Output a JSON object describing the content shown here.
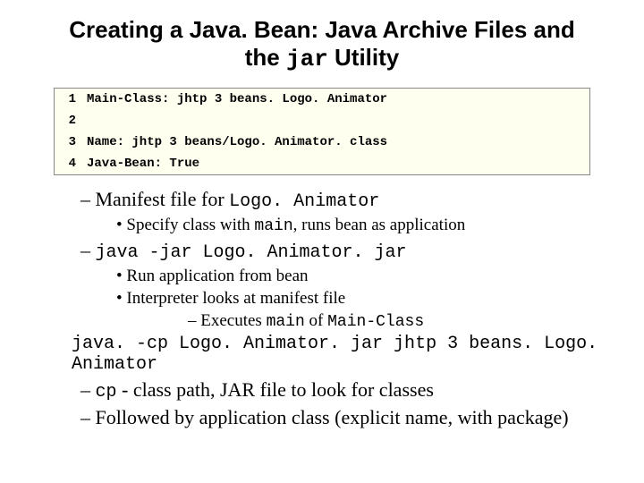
{
  "title": {
    "line1": "Creating a Java. Bean: Java Archive Files and",
    "line2_prefix": "the ",
    "line2_jar": "jar",
    "line2_suffix": " Utility"
  },
  "code": {
    "lines": [
      {
        "n": "1",
        "text": "Main-Class: jhtp 3 beans. Logo. Animator"
      },
      {
        "n": "2",
        "text": ""
      },
      {
        "n": "3",
        "text": "Name: jhtp 3 beans/Logo. Animator. class"
      },
      {
        "n": "4",
        "text": "Java-Bean: True"
      }
    ]
  },
  "items": {
    "manifest_pre": "Manifest file for ",
    "manifest_mono": "Logo. Animator",
    "specify_pre": "Specify class with ",
    "specify_mono": "main",
    "specify_post": ", runs bean as application",
    "java_jar": "java -jar Logo. Animator. jar",
    "run_from_bean": "Run application from bean",
    "interpreter": "Interpreter looks at manifest file",
    "executes_pre": "Executes ",
    "executes_main": "main",
    "executes_mid": " of ",
    "executes_mc": "Main-Class",
    "java_cp": "java. -cp Logo. Animator. jar jhtp 3 beans. Logo. Animator",
    "cp_mono": "cp",
    "cp_rest": " - class path, JAR file to look for classes",
    "followed": "Followed by application class (explicit name, with package)"
  }
}
